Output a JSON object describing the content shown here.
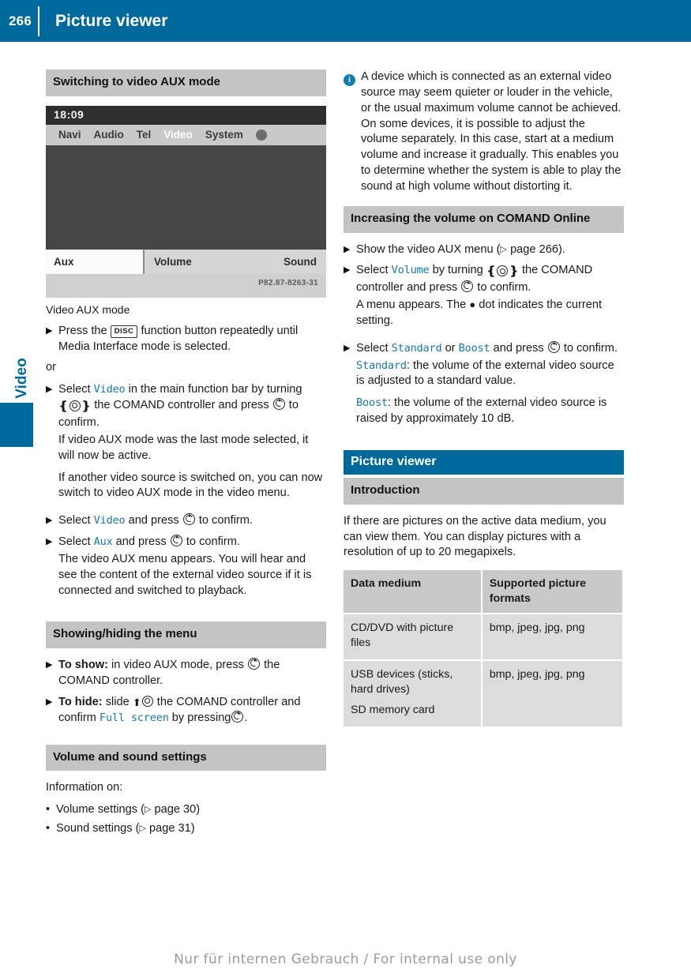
{
  "header": {
    "page_number": "266",
    "title": "Picture viewer",
    "accent_color": "#00699c"
  },
  "side_tab": {
    "label": "Video"
  },
  "left_column": {
    "heading_switching": "Switching to video AUX mode",
    "screenshot": {
      "clock": "18:09",
      "menu_items": [
        "Navi",
        "Audio",
        "Tel",
        "Video",
        "System"
      ],
      "active_menu_item": "Video",
      "softkeys": [
        "Aux",
        "Volume",
        "Sound"
      ],
      "code": "P82.87-8263-31"
    },
    "caption": "Video AUX mode",
    "step1_a": "Press the",
    "step1_key": "DISC",
    "step1_b": "function button repeatedly until Media Interface mode is selected.",
    "or_label": "or",
    "step2_a": "Select",
    "step2_code": "Video",
    "step2_b": "in the main function bar by turning",
    "step2_c": "the COMAND controller and press",
    "step2_d": "to confirm.",
    "step2_note1": "If video AUX mode was the last mode selected, it will now be active.",
    "step2_note2": "If another video source is switched on, you can now switch to video AUX mode in the video menu.",
    "step3_a": "Select",
    "step3_code": "Video",
    "step3_b": "and press",
    "step3_c": "to confirm.",
    "step4_a": "Select",
    "step4_code": "Aux",
    "step4_b": "and press",
    "step4_c": "to confirm.",
    "step4_note": "The video AUX menu appears. You will hear and see the content of the external video source if it is connected and switched to playback.",
    "heading_showhide": "Showing/hiding the menu",
    "show_label": "To show:",
    "show_a": "in video AUX mode, press",
    "show_b": "the COMAND controller.",
    "hide_label": "To hide:",
    "hide_a": "slide",
    "hide_b": "the COMAND controller and confirm",
    "hide_code": "Full screen",
    "hide_c": "by pressing",
    "hide_d": ".",
    "heading_volume": "Volume and sound settings",
    "info_on": "Information on:",
    "bullets": [
      {
        "text": "Volume settings (",
        "ref": "page 30",
        "tail": ")"
      },
      {
        "text": "Sound settings (",
        "ref": "page 31",
        "tail": ")"
      }
    ]
  },
  "right_column": {
    "note": "A device which is connected as an external video source may seem quieter or louder in the vehicle, or the usual maximum volume cannot be achieved. On some devices, it is possible to adjust the volume separately. In this case, start at a medium volume and increase it gradually. This enables you to determine whether the system is able to play the sound at high volume without distorting it.",
    "heading_increase": "Increasing the volume on COMAND Online",
    "v_step1_a": "Show the video AUX menu (",
    "v_step1_ref": "page 266",
    "v_step1_b": ").",
    "v_step2_a": "Select",
    "v_step2_code": "Volume",
    "v_step2_b": "by turning",
    "v_step2_c": "the COMAND controller and press",
    "v_step2_d": "to confirm.",
    "v_step2_note_a": "A menu appears. The",
    "v_step2_note_b": "dot indicates the current setting.",
    "v_step3_a": "Select",
    "v_step3_code1": "Standard",
    "v_step3_or": "or",
    "v_step3_code2": "Boost",
    "v_step3_b": "and press",
    "v_step3_c": "to confirm.",
    "v_std_code": "Standard",
    "v_std_text": ": the volume of the external video source is adjusted to a standard value.",
    "v_boost_code": "Boost",
    "v_boost_text": ": the volume of the external video source is raised by approximately 10 dB.",
    "heading_picture_viewer": "Picture viewer",
    "heading_introduction": "Introduction",
    "intro_text": "If there are pictures on the active data medium, you can view them. You can display pictures with a resolution of up to 20 megapixels.",
    "table": {
      "headers": [
        "Data medium",
        "Supported picture formats"
      ],
      "rows": [
        {
          "medium": [
            "CD/DVD with picture files"
          ],
          "formats": "bmp, jpeg, jpg, png"
        },
        {
          "medium": [
            "USB devices (sticks, hard drives)",
            "SD memory card"
          ],
          "formats": "bmp, jpeg, jpg, png"
        }
      ]
    }
  },
  "footer": {
    "text": "Nur für internen Gebrauch / For internal use only"
  }
}
